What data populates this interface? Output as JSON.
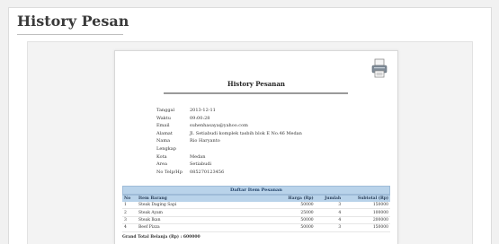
{
  "page": {
    "title": "History Pesan"
  },
  "receipt": {
    "title": "History Pesanan",
    "fields": [
      {
        "label": "Tanggal",
        "value": "2013-12-11"
      },
      {
        "label": "Waktu",
        "value": "09:00:28"
      },
      {
        "label": "Email",
        "value": "suhenhasaya@yahoo.com"
      },
      {
        "label": "Alamat",
        "value": "Jl. Setiabudi komplek tasbih blok E No.46 Medan"
      },
      {
        "label": "Nama Lengkap",
        "value": "Rio Haryanto"
      },
      {
        "label": "Kota",
        "value": "Medan"
      },
      {
        "label": "Area",
        "value": "Setiabudi"
      },
      {
        "label": "No Telp/Hp",
        "value": "085270123456"
      }
    ],
    "table": {
      "caption": "Daftar Item Pesanan",
      "headers": [
        "No",
        "Item Barang",
        "Harga (Rp)",
        "Jumlah",
        "Subtotal (Rp)"
      ],
      "rows": [
        [
          "1",
          "Steak Daging Sapi",
          "50000",
          "3",
          "150000"
        ],
        [
          "2",
          "Steak Ayam",
          "25000",
          "4",
          "100000"
        ],
        [
          "3",
          "Steak Ikan",
          "50000",
          "4",
          "200000"
        ],
        [
          "4",
          "Beef Pizza",
          "50000",
          "3",
          "150000"
        ]
      ],
      "grand_total": "Grand Total Belanja (Rp) : 600000"
    }
  }
}
